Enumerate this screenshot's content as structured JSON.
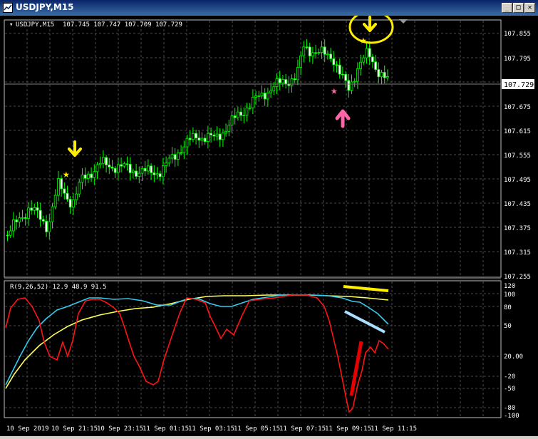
{
  "window": {
    "title": "USDJPY,M15",
    "buttons": {
      "minimize": "_",
      "maximize": "□",
      "close": "✕"
    }
  },
  "main_chart": {
    "symbol_label": "USDJPY,M15",
    "ohlc_label": "107.745 107.747 107.709 107.729",
    "price_labels": [
      "107.855",
      "107.795",
      "107.675",
      "107.615",
      "107.555",
      "107.495",
      "107.435",
      "107.375",
      "107.315",
      "107.255"
    ],
    "current_price": "107.729"
  },
  "indicator": {
    "label": "R(9,26,52) 12.9 48.9 91.5",
    "level_labels": [
      "120",
      "100",
      "80",
      "50",
      "20.00",
      "-20",
      "-50",
      "-80",
      "-100"
    ]
  },
  "time_labels": [
    "10 Sep 2019",
    "10 Sep 21:15",
    "10 Sep 23:15",
    "11 Sep 01:15",
    "11 Sep 03:15",
    "11 Sep 05:15",
    "11 Sep 07:15",
    "11 Sep 09:15",
    "11 Sep 11:15"
  ],
  "colors": {
    "bull": "#00ff00",
    "bear": "#ffffff",
    "grid": "#4a4a4a",
    "red_line": "#ff1414",
    "cyan_line": "#33ccf0",
    "yellow_line": "#ffff5a",
    "annotation_yellow": "#ffee00",
    "annotation_pink": "#ff66aa",
    "annotation_red": "#e80000",
    "annotation_lightblue": "#aaddff"
  },
  "annotations": [
    "down-arrow",
    "star",
    "pink-up-arrow",
    "yellow-circle"
  ]
}
